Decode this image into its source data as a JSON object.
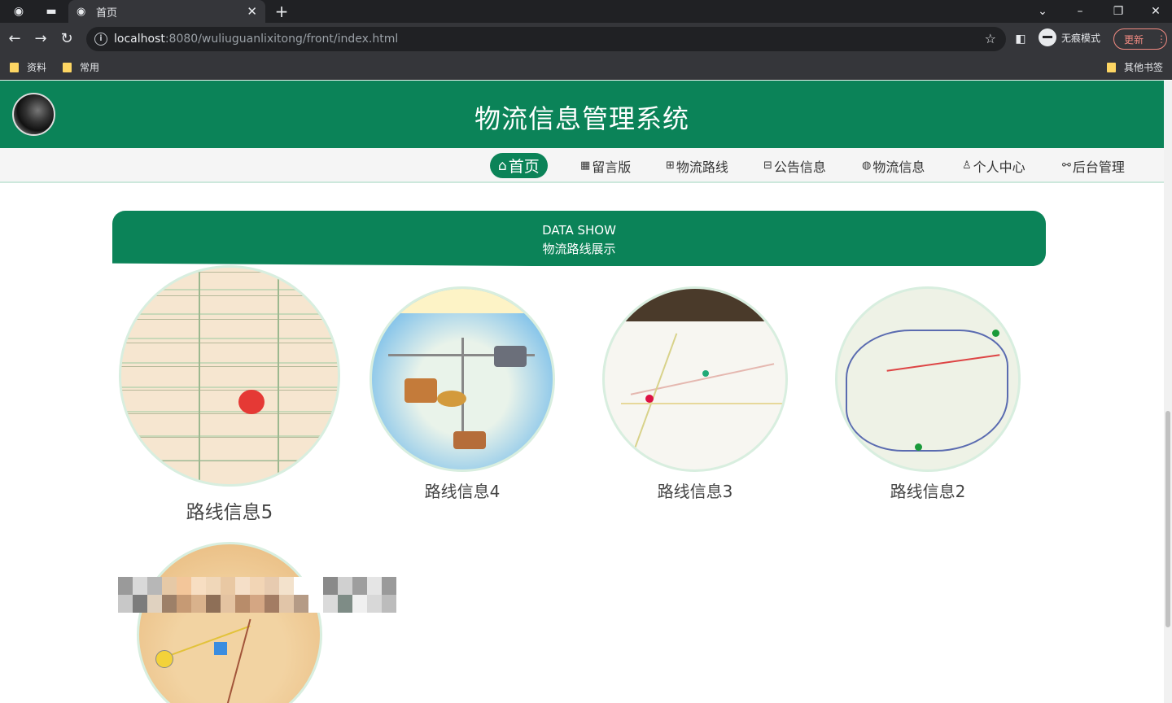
{
  "browser": {
    "tab_title": "首页",
    "url_host": "localhost",
    "url_rest": ":8080/wuliuguanlixitong/front/index.html",
    "incognito_label": "无痕模式",
    "update_label": "更新",
    "bookmarks": [
      "资料",
      "常用"
    ],
    "other_bookmarks": "其他书签"
  },
  "site": {
    "title": "物流信息管理系统",
    "nav": [
      {
        "label": "首页",
        "glyph": "⌂"
      },
      {
        "label": "留言版",
        "glyph": "▦"
      },
      {
        "label": "物流路线",
        "glyph": "⊞"
      },
      {
        "label": "公告信息",
        "glyph": "⊟"
      },
      {
        "label": "物流信息",
        "glyph": "◍"
      },
      {
        "label": "个人中心",
        "glyph": "♙"
      },
      {
        "label": "后台管理",
        "glyph": "⚯"
      }
    ]
  },
  "section": {
    "title_en": "DATA SHOW",
    "title_cn": "物流路线展示"
  },
  "routes": [
    {
      "caption": "路线信息5"
    },
    {
      "caption": "路线信息4"
    },
    {
      "caption": "路线信息3"
    },
    {
      "caption": "路线信息2"
    }
  ],
  "colors": {
    "brand": "#0b8358"
  }
}
